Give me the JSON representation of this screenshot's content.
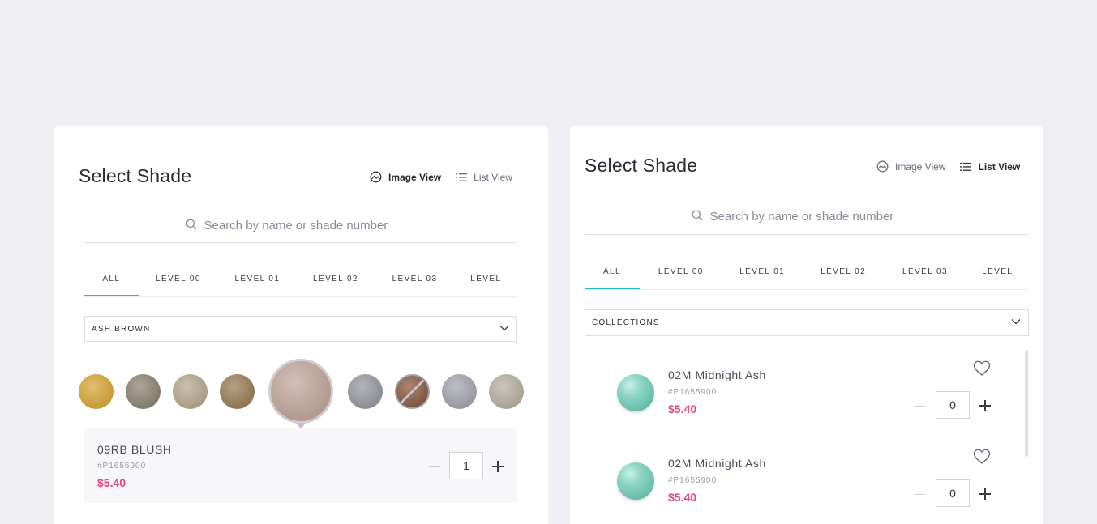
{
  "left_panel": {
    "title": "Select Shade",
    "view_toggle": {
      "image_view": "Image View",
      "list_view": "List View",
      "active": "image"
    },
    "search": {
      "placeholder": "Search by name or shade number"
    },
    "tabs": [
      "ALL",
      "LEVEL 00",
      "LEVEL 01",
      "LEVEL 02",
      "LEVEL 03",
      "LEVEL"
    ],
    "active_tab": "ALL",
    "dropdown": {
      "selected": "ASH BROWN"
    },
    "swatches": [
      {
        "color": "#d9a83e",
        "name": "swatch-golden"
      },
      {
        "color": "#8f8676",
        "name": "swatch-ash-gray"
      },
      {
        "color": "#b7aa90",
        "name": "swatch-sand"
      },
      {
        "color": "#9c8058",
        "name": "swatch-light-brown"
      },
      {
        "color": "#c2a89e",
        "name": "swatch-blush",
        "selected": true
      },
      {
        "color": "#9a9aa4",
        "name": "swatch-silver"
      },
      {
        "color": "#8c6048",
        "name": "swatch-copper-unavailable",
        "unavailable": true
      },
      {
        "color": "#a6a6b0",
        "name": "swatch-light-silver"
      },
      {
        "color": "#b8b0a4",
        "name": "swatch-pearl"
      }
    ],
    "selected_shade": {
      "name": "09RB BLUSH",
      "code": "#P1655900",
      "price": "$5.40",
      "quantity": "1"
    }
  },
  "right_panel": {
    "title": "Select Shade",
    "view_toggle": {
      "image_view": "Image View",
      "list_view": "List View",
      "active": "list"
    },
    "search": {
      "placeholder": "Search by name or shade number"
    },
    "tabs": [
      "ALL",
      "LEVEL 00",
      "LEVEL 01",
      "LEVEL 02",
      "LEVEL 03",
      "LEVEL"
    ],
    "active_tab": "ALL",
    "dropdown": {
      "selected": "COLLECTIONS"
    },
    "items": [
      {
        "name": "02M Midnight Ash",
        "code": "#P1655900",
        "price": "$5.40",
        "quantity": "0"
      },
      {
        "name": "02M Midnight Ash",
        "code": "#P1655900",
        "price": "$5.40",
        "quantity": "0"
      }
    ]
  },
  "colors": {
    "accent_tab": "#1fbccf",
    "price": "#e4457f",
    "background": "#f0f0f4"
  }
}
